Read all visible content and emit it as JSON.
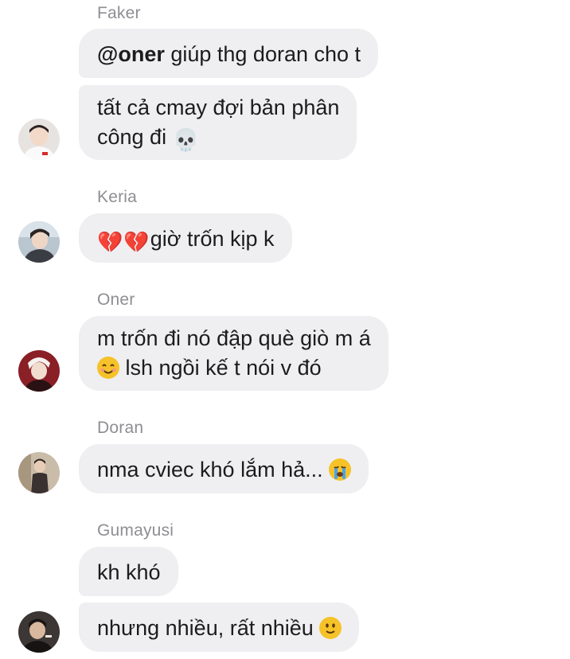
{
  "messages": [
    {
      "sender": "Faker",
      "bubbles": [
        {
          "mention": "@oner",
          "text": " giúp thg doran cho t"
        },
        {
          "line1": "tất cả cmay đợi bản phân",
          "line2_text": "công đi ",
          "emoji": "skull"
        }
      ]
    },
    {
      "sender": "Keria",
      "bubbles": [
        {
          "emoji": "broken-heart",
          "emoji_count": 2,
          "text": "giờ trốn kịp k"
        }
      ]
    },
    {
      "sender": "Oner",
      "bubbles": [
        {
          "line1": "m trốn đi nó đập què giò m á",
          "emoji": "smiling-face",
          "line2_text": " lsh ngồi kế t nói v đó"
        }
      ]
    },
    {
      "sender": "Doran",
      "bubbles": [
        {
          "text": "nma cviec khó lắm hả... ",
          "emoji": "crying-face"
        }
      ]
    },
    {
      "sender": "Gumayusi",
      "bubbles": [
        {
          "text": "kh khó"
        },
        {
          "text": "nhưng nhiều, rất nhiều ",
          "emoji": "slightly-smiling-face"
        }
      ]
    }
  ],
  "glyphs": {
    "skull": "💀",
    "broken_heart": "💔"
  },
  "colors": {
    "bubble": "#efeff1",
    "sender": "#8e8e93",
    "text": "#1c1c1e"
  }
}
